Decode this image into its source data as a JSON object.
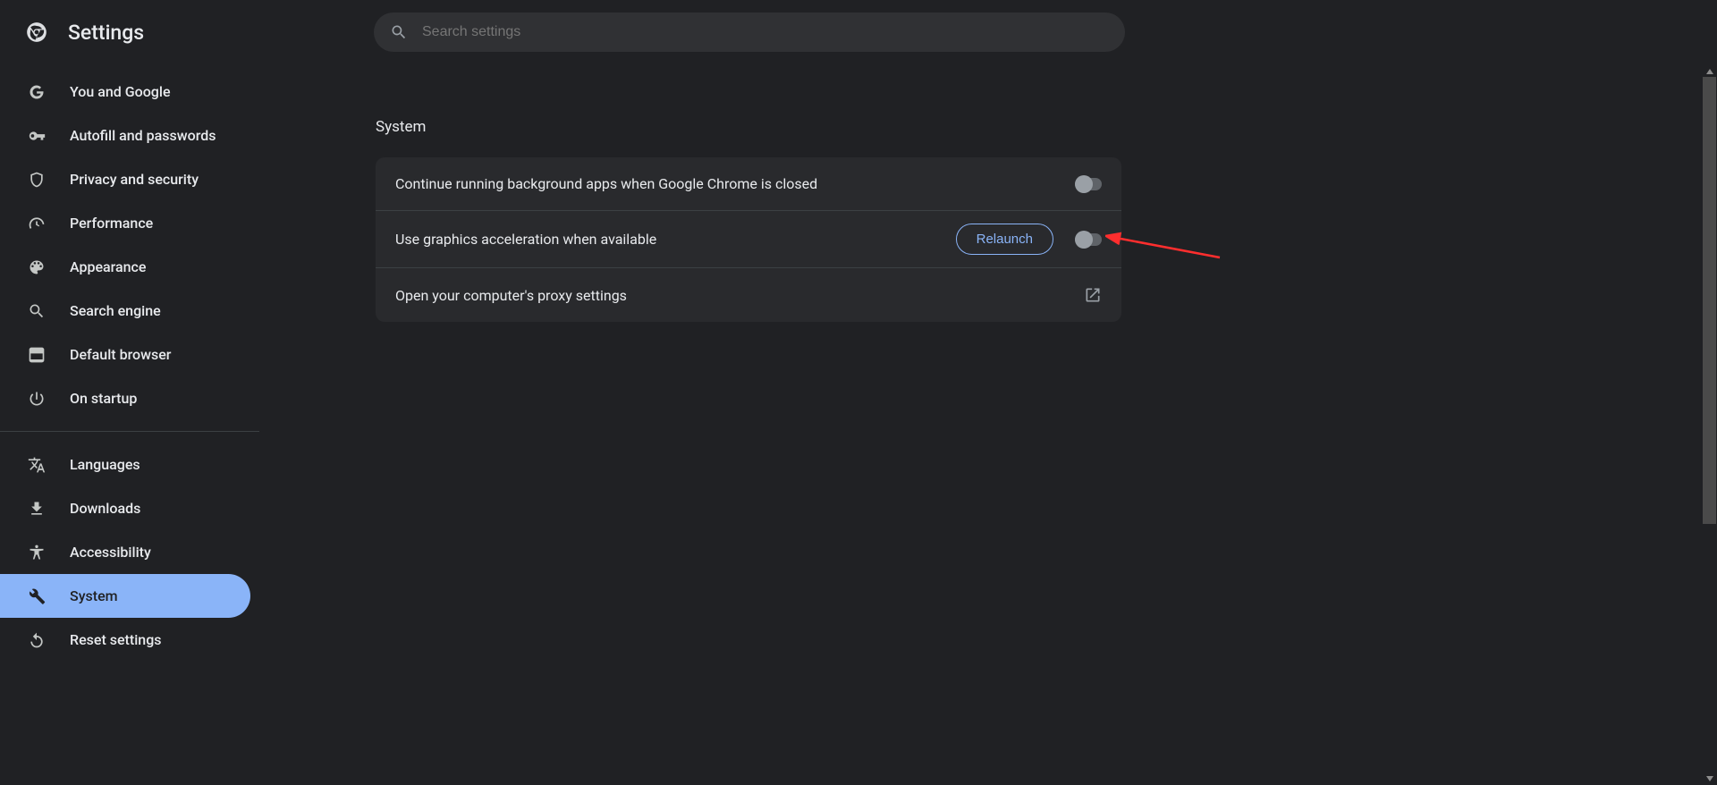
{
  "header": {
    "title": "Settings"
  },
  "search": {
    "placeholder": "Search settings"
  },
  "sidebar": {
    "items": [
      {
        "id": "you-google",
        "label": "You and Google"
      },
      {
        "id": "autofill",
        "label": "Autofill and passwords"
      },
      {
        "id": "privacy",
        "label": "Privacy and security"
      },
      {
        "id": "performance",
        "label": "Performance"
      },
      {
        "id": "appearance",
        "label": "Appearance"
      },
      {
        "id": "search-engine",
        "label": "Search engine"
      },
      {
        "id": "default-browser",
        "label": "Default browser"
      },
      {
        "id": "startup",
        "label": "On startup"
      }
    ],
    "items2": [
      {
        "id": "languages",
        "label": "Languages"
      },
      {
        "id": "downloads",
        "label": "Downloads"
      },
      {
        "id": "accessibility",
        "label": "Accessibility"
      },
      {
        "id": "system",
        "label": "System",
        "selected": true
      },
      {
        "id": "reset",
        "label": "Reset settings"
      }
    ]
  },
  "main": {
    "section_title": "System",
    "rows": {
      "bg_apps": {
        "label": "Continue running background apps when Google Chrome is closed",
        "toggle": false
      },
      "gpu": {
        "label": "Use graphics acceleration when available",
        "action": "Relaunch",
        "toggle": false
      },
      "proxy": {
        "label": "Open your computer's proxy settings"
      }
    }
  }
}
